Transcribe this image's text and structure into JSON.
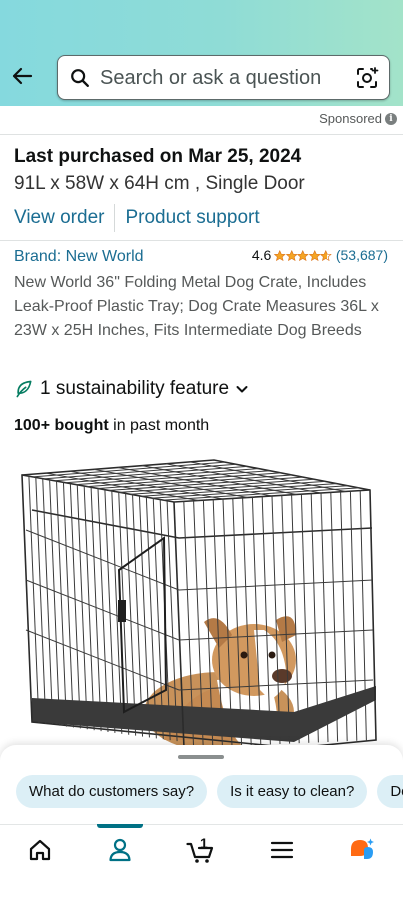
{
  "header": {
    "search_placeholder": "Search or ask a question"
  },
  "sponsored_label": "Sponsored",
  "purchase": {
    "last_purchased": "Last purchased on Mar 25, 2024",
    "variant": "91L x 58W x 64H cm , Single Door",
    "view_order": "View order",
    "product_support": "Product support"
  },
  "product": {
    "brand": "Brand: New World",
    "rating_value": "4.6",
    "stars": 4.6,
    "rating_count": "(53,687)",
    "title": "New World 36\" Folding Metal Dog Crate, Includes Leak-Proof Plastic Tray; Dog Crate Measures 36L x 23W x 25H Inches, Fits Intermediate Dog Breeds",
    "sustainability": "1 sustainability feature",
    "bought_bold": "100+ bought",
    "bought_rest": " in past month"
  },
  "chips": [
    "What do customers say?",
    "Is it easy to clean?",
    "Do"
  ],
  "tabbar": {
    "cart_count": "1",
    "active_tab": "account"
  },
  "colors": {
    "link": "#1b6d92",
    "star": "#f5a524",
    "chip_bg": "#dceff6",
    "active_tab": "#007185",
    "leaf": "#067d62"
  }
}
